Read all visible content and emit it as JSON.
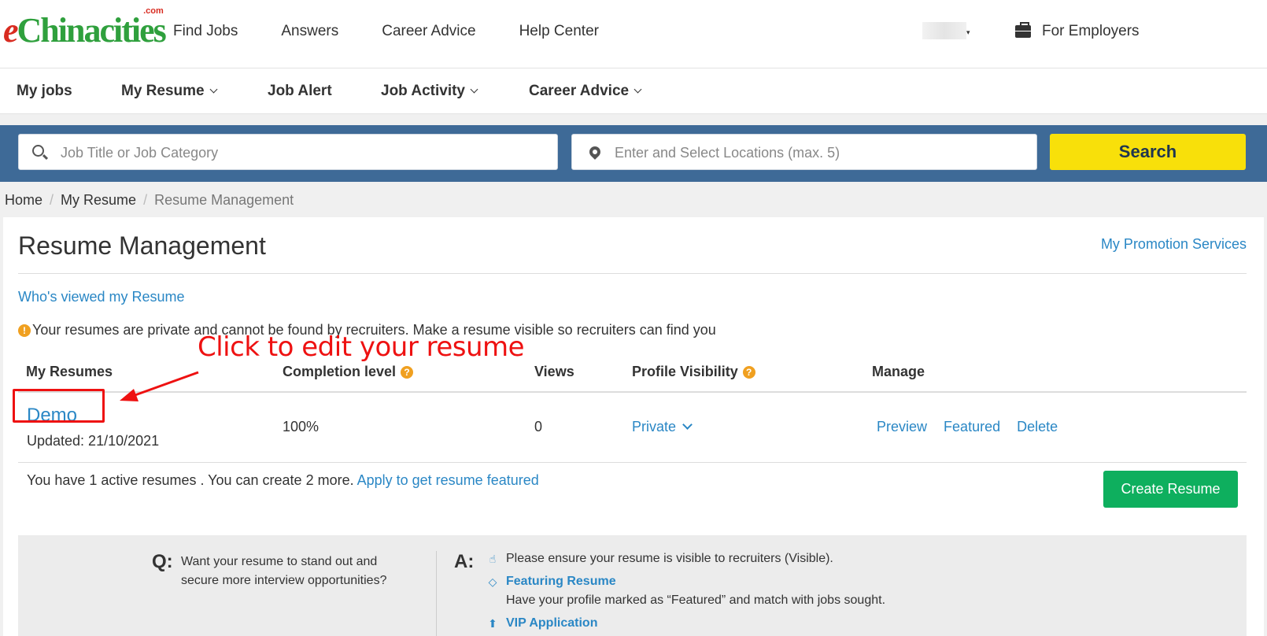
{
  "header": {
    "logo": {
      "e": "e",
      "rest": "Chinacities",
      "dotcom": ".com"
    },
    "nav": [
      "Find Jobs",
      "Answers",
      "Career Advice",
      "Help Center"
    ],
    "employers_label": "For Employers"
  },
  "subnav": {
    "my_jobs": "My jobs",
    "my_resume": "My Resume",
    "job_alert": "Job Alert",
    "job_activity": "Job Activity",
    "career_advice": "Career Advice"
  },
  "search": {
    "job_placeholder": "Job Title or Job Category",
    "location_placeholder": "Enter and Select Locations (max. 5)",
    "button": "Search"
  },
  "breadcrumb": [
    "Home",
    "My Resume",
    "Resume Management"
  ],
  "page": {
    "title": "Resume Management",
    "promo_link": "My Promotion Services",
    "viewed_link": "Who's viewed my Resume",
    "notice": "Your resumes are private and cannot be found by recruiters. Make a resume visible so recruiters can find you"
  },
  "table": {
    "headers": {
      "resumes": "My Resumes",
      "completion": "Completion level",
      "views": "Views",
      "visibility": "Profile Visibility",
      "manage": "Manage"
    },
    "rows": [
      {
        "name": "Demo",
        "updated": "Updated: 21/10/2021",
        "completion": "100%",
        "views": "0",
        "visibility": "Private",
        "actions": [
          "Preview",
          "Featured",
          "Delete"
        ]
      }
    ]
  },
  "summary": {
    "text": "You have 1 active resumes . You can create 2 more.",
    "link": "Apply to get resume featured",
    "create_button": "Create Resume"
  },
  "faq": {
    "q_label": "Q:",
    "question": "Want your resume to stand out and secure more interview opportunities?",
    "a_label": "A:",
    "answer_visible": "Please ensure your resume is visible to recruiters (Visible).",
    "featuring_title": "Featuring Resume",
    "featuring_desc": "Have your profile marked as “Featured” and match with jobs sought.",
    "vip_title": "VIP Application"
  },
  "annotation": {
    "text": "Click to edit your resume"
  },
  "colors": {
    "link": "#2a87c5",
    "search_band": "#3e6a97",
    "search_button": "#f8e00a",
    "create_button": "#0eaf5e",
    "annotation": "#ee1111"
  }
}
